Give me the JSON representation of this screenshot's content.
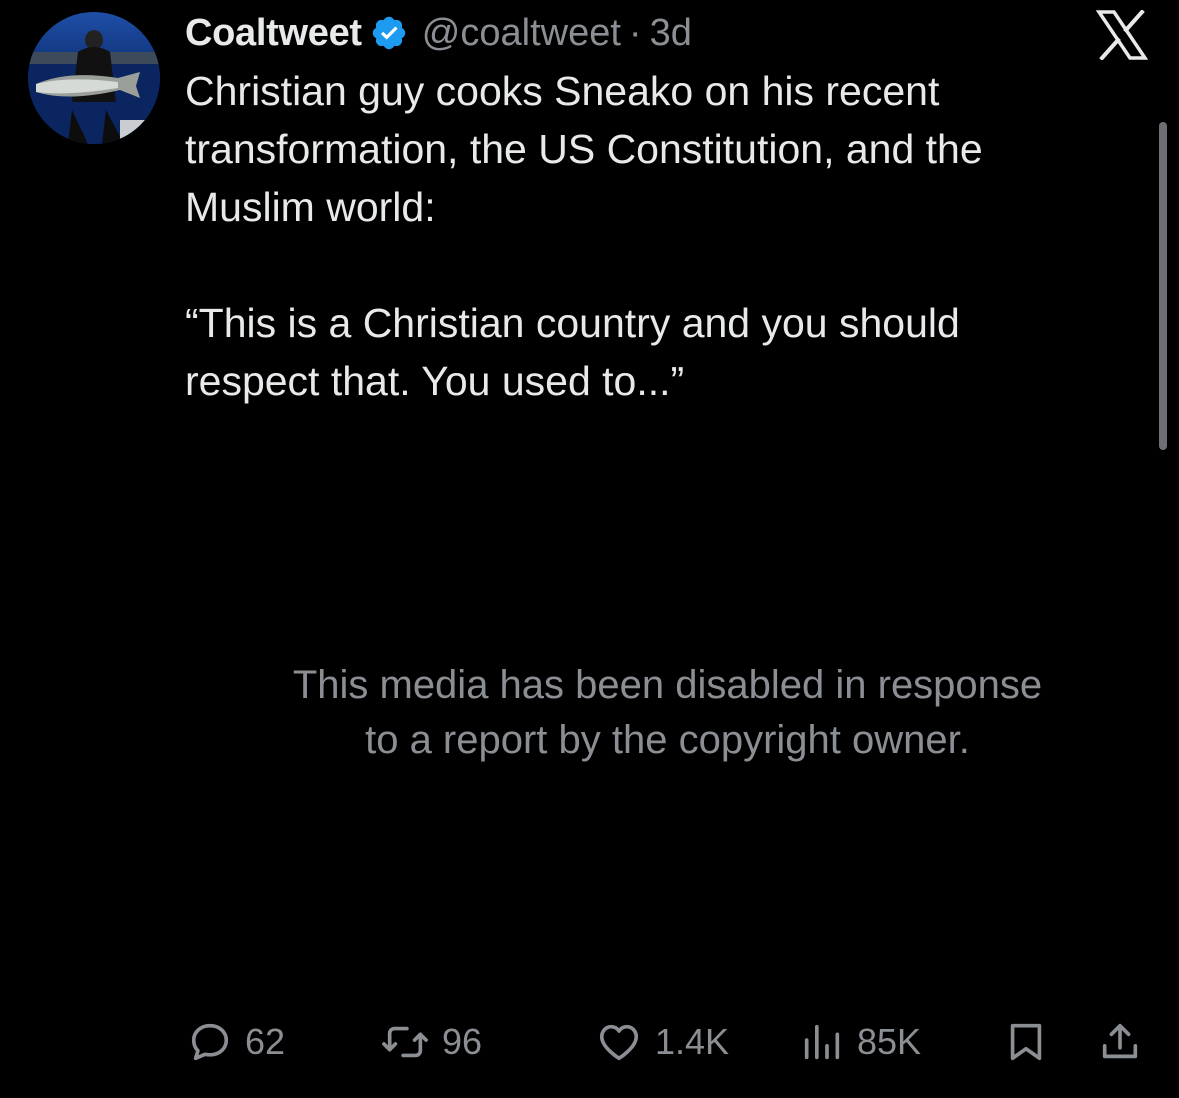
{
  "author": {
    "display_name": "Coaltweet",
    "handle": "@coaltweet",
    "separator": "·",
    "time": "3d",
    "verified": true
  },
  "tweet": {
    "text": "Christian guy cooks Sneako on his recent\ntransformation, the US Constitution, and the\nMuslim world:\n\n“This is a Christian country and you should\nrespect that. You used to...”"
  },
  "media": {
    "notice": "This media has been disabled in response\nto a report by the copyright owner."
  },
  "actions": {
    "replies": "62",
    "reposts": "96",
    "likes": "1.4K",
    "views": "85K"
  },
  "colors": {
    "background": "#000000",
    "text": "#e7e9ea",
    "secondary": "#8b8f94",
    "verified": "#1d9bf0"
  },
  "icons": {
    "brand": "x-logo-icon",
    "verified": "verified-badge-icon",
    "reply": "reply-icon",
    "repost": "repost-icon",
    "like": "heart-icon",
    "views": "views-chart-icon",
    "bookmark": "bookmark-icon",
    "share": "share-icon"
  }
}
